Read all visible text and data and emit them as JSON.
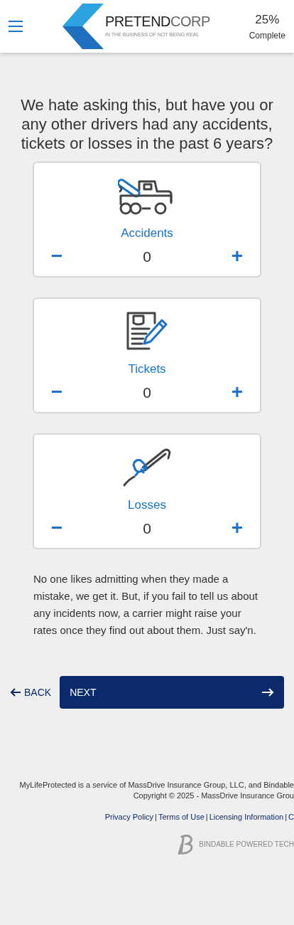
{
  "header": {
    "logo_name": "**PRETEND**CORP",
    "logo_tagline": "IN THE BUSINESS OF NOT BEING REAL",
    "progress_percent": "25%",
    "progress_label": "Complete"
  },
  "question": "We hate asking this, but have you or any other drivers had any accidents, tickets or losses in the past 6 years?",
  "counters": [
    {
      "kind": "truck",
      "label": "Accidents",
      "value": "0",
      "minus": "−",
      "plus": "+"
    },
    {
      "kind": "document",
      "label": "Tickets",
      "value": "0",
      "minus": "−",
      "plus": "+"
    },
    {
      "kind": "crowbar",
      "label": "Losses",
      "value": "0",
      "minus": "−",
      "plus": "+"
    }
  ],
  "note": "No one likes admitting when they made a mistake, we get it. But, if you fail to tell us about any incidents now, a carrier might raise your rates once they find out about them. Just say'n.",
  "nav": {
    "back": "BACK",
    "next": "NEXT"
  },
  "footer": {
    "lines": [
      "MyLifeProtected is a service of MassDrive Insurance Group, LLC, and Bindable",
      "Copyright © 2025 - MassDrive Insurance Grou"
    ],
    "links": [
      "Privacy Policy",
      "Terms of Use",
      "Licensing Information",
      "C"
    ],
    "link_separator": "|",
    "powered": "BINDABLE POWERED TECH"
  }
}
